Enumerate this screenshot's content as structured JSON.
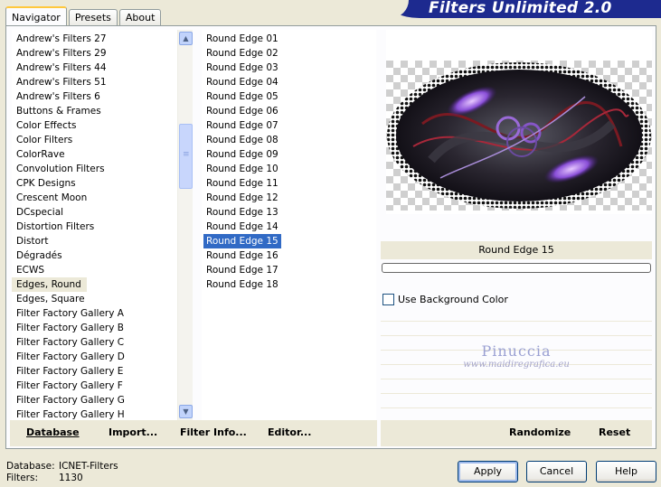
{
  "tabs": [
    {
      "label": "Navigator",
      "active": true
    },
    {
      "label": "Presets",
      "active": false
    },
    {
      "label": "About",
      "active": false
    }
  ],
  "brand": "Filters Unlimited 2.0",
  "categories": {
    "items": [
      "Andrew's Filters 27",
      "Andrew's Filters 29",
      "Andrew's Filters 44",
      "Andrew's Filters 51",
      "Andrew's Filters 6",
      "Buttons & Frames",
      "Color Effects",
      "Color Filters",
      "ColorRave",
      "Convolution Filters",
      "CPK Designs",
      "Crescent Moon",
      "DCspecial",
      "Distortion Filters",
      "Distort",
      "Dégradés",
      "ECWS",
      "Edges, Round",
      "Edges, Square",
      "Filter Factory Gallery A",
      "Filter Factory Gallery B",
      "Filter Factory Gallery C",
      "Filter Factory Gallery D",
      "Filter Factory Gallery E",
      "Filter Factory Gallery F",
      "Filter Factory Gallery G",
      "Filter Factory Gallery H"
    ],
    "selected": "Edges, Round"
  },
  "filters": {
    "items": [
      "Round Edge 01",
      "Round Edge 02",
      "Round Edge 03",
      "Round Edge 04",
      "Round Edge 05",
      "Round Edge 06",
      "Round Edge 07",
      "Round Edge 08",
      "Round Edge 09",
      "Round Edge 10",
      "Round Edge 11",
      "Round Edge 12",
      "Round Edge 13",
      "Round Edge 14",
      "Round Edge 15",
      "Round Edge 16",
      "Round Edge 17",
      "Round Edge 18"
    ],
    "selected": "Round Edge 15"
  },
  "preview": {
    "filter_name": "Round Edge 15",
    "progress_percent": 0
  },
  "params": {
    "use_bg_color_label": "Use Background Color",
    "use_bg_color_checked": false
  },
  "watermark": {
    "line1": "Pinuccia",
    "line2": "www.maidiregrafica.eu"
  },
  "toolbar_left": {
    "database": "Database",
    "import": "Import...",
    "filter_info": "Filter Info...",
    "editor": "Editor..."
  },
  "toolbar_right": {
    "randomize": "Randomize",
    "reset": "Reset"
  },
  "footer": {
    "database_label": "Database:",
    "database_value": "ICNET-Filters",
    "filters_label": "Filters:",
    "filters_value": "1130"
  },
  "buttons": {
    "apply": "Apply",
    "cancel": "Cancel",
    "help": "Help"
  },
  "colors": {
    "brand_bg": "#1d2a8f",
    "selection": "#316ac5",
    "dialog_bg": "#ece9d8",
    "preview_glow": "#8a4fd8"
  }
}
